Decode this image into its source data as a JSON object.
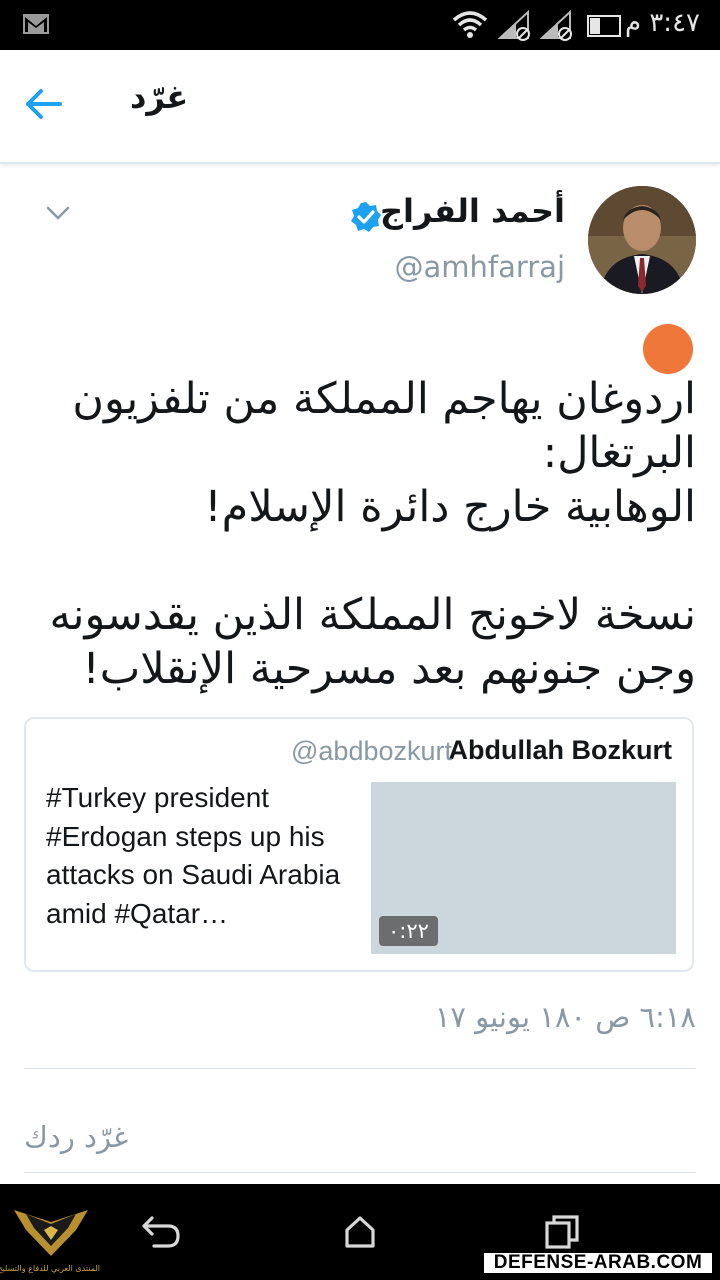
{
  "status_bar": {
    "time": "٣:٤٧ م",
    "icons": [
      "gmail-icon",
      "wifi-icon",
      "signal-muted-icon",
      "signal-muted-icon",
      "battery-icon"
    ]
  },
  "app_bar": {
    "title": "غرّد",
    "back_icon": "arrow-left-icon"
  },
  "tweet": {
    "author_name": "أحمد الفراج",
    "verified": true,
    "handle": "@amhfarraj",
    "text": "اردوغان يهاجم المملكة من تلفزيون البرتغال:\nالوهابية خارج دائرة الإسلام!\n\nنسخة لاخونج المملكة الذين يقدسونه وجن جنونهم بعد مسرحية الإنقلاب!",
    "timestamp": "٦:١٨ ص ١٨٠ يونيو ١٧",
    "accent_color": "#f0773a"
  },
  "quoted_tweet": {
    "name": "Abdullah Bozkurt",
    "handle": "@abdbozkurt",
    "text": "#Turkey president #Erdogan steps up his attacks on Saudi Arabia amid #Qatar…",
    "video_duration": "٠:٢٢"
  },
  "reply": {
    "placeholder": "غرّد ردك"
  },
  "watermark": {
    "site": "DEFENSE-ARAB.COM",
    "logo_caption": "المنتدى العربي للدفاع والتسليح"
  },
  "colors": {
    "twitter_blue": "#1da1f2",
    "secondary_text": "#8899a6",
    "media_placeholder": "#ccd6dd"
  }
}
